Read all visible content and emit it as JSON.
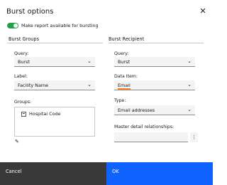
{
  "dialog": {
    "title": "Burst options",
    "close_glyph": "✕"
  },
  "toggle": {
    "label": "Make report available for bursting",
    "state": "on",
    "color": "#24a148"
  },
  "burst_groups": {
    "title": "Burst Groups",
    "query": {
      "label": "Query:",
      "value": "Burst"
    },
    "label_field": {
      "label": "Label:",
      "value": "Facility Name"
    },
    "groups": {
      "label": "Groups:",
      "items": [
        "Hospital Code"
      ]
    },
    "edit_icon_glyph": "✎"
  },
  "burst_recipient": {
    "title": "Burst Recipient",
    "query": {
      "label": "Query:",
      "value": "Burst"
    },
    "data_item": {
      "label": "Data Item:",
      "value": "Email"
    },
    "type": {
      "label": "Type:",
      "value": "Email addresses"
    },
    "master_detail": {
      "label": "Master detail relationships:",
      "value": "",
      "menu_glyph": "⋮"
    }
  },
  "chevron_glyph": "⌄",
  "footer": {
    "cancel_label": "Cancel",
    "ok_label": "OK",
    "cancel_color": "#393939",
    "ok_color": "#0f62fe"
  },
  "accent_color": "#ff832b"
}
